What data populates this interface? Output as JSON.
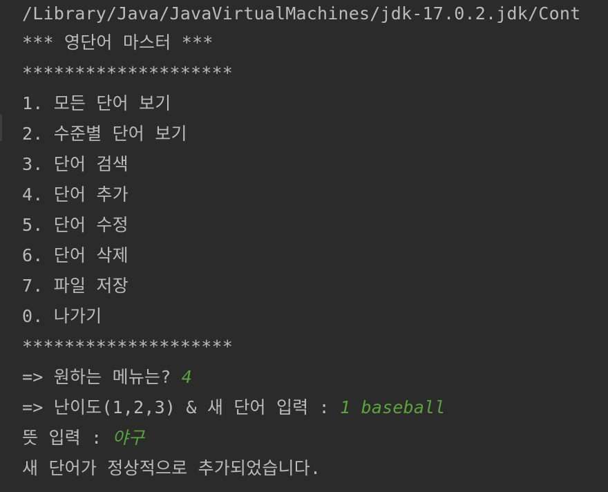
{
  "console": {
    "path_line": "/Library/Java/JavaVirtualMachines/jdk-17.0.2.jdk/Cont",
    "title_line": "*** 영단어 마스터 ***",
    "separator_top": "********************",
    "menu_items": [
      "1. 모든 단어 보기",
      "2. 수준별 단어 보기",
      "3. 단어 검색",
      "4. 단어 추가",
      "5. 단어 수정",
      "6. 단어 삭제",
      "7. 파일 저장",
      "0. 나가기"
    ],
    "separator_bottom": "********************",
    "prompt_menu": "=> 원하는 메뉴는? ",
    "prompt_menu_input": "4",
    "prompt_word": "=> 난이도(1,2,3) & 새 단어 입력 : ",
    "prompt_word_input": "1 baseball",
    "prompt_meaning": "뜻 입력 : ",
    "prompt_meaning_input": "야구",
    "result_message": "새 단어가 정상적으로 추가되었습니다."
  },
  "colors": {
    "background": "#2b2b2b",
    "output_text": "#bbbbbb",
    "user_input": "#5aa53b"
  }
}
